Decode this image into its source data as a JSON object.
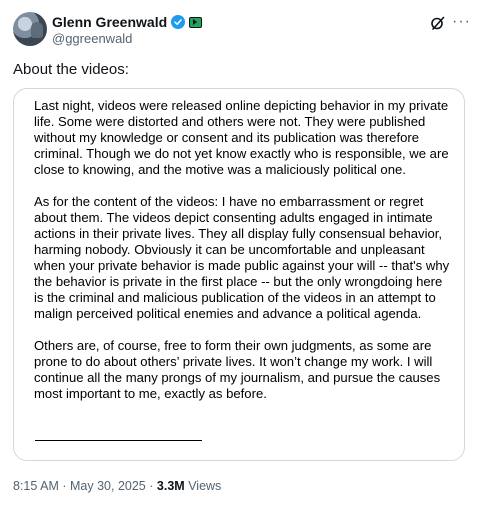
{
  "author": {
    "name": "Glenn Greenwald",
    "handle": "@ggreenwald"
  },
  "tweet": {
    "intro_text": "About the videos:",
    "paragraphs": [
      "Last night, videos were released online depicting behavior in my private life. Some were distorted and others were not. They were published without my knowledge or consent and its publication was therefore criminal. Though we do not yet know exactly who is responsible, we are close to knowing, and the motive was a maliciously political one.",
      "As for the content of the videos: I have no embarrassment or regret about them. The videos depict consenting adults engaged in intimate actions in their private lives. They all display fully consensual behavior, harming nobody. Obviously it can be uncomfortable and unpleasant when your private behavior is made public against your will -- that's why the behavior is private in the first place -- but the only wrongdoing here is the criminal and malicious publication of the videos in an attempt to malign perceived political enemies and advance a political agenda.",
      "Others are, of course, free to form their own judgments, as some are prone to do about others’ private lives. It won’t change my work. I will continue all the many prongs of my journalism, and pursue the causes most important to me, exactly as before."
    ]
  },
  "meta": {
    "time": "8:15 AM",
    "separator": "·",
    "date": "May 30, 2025",
    "views_count": "3.3M",
    "views_label": "Views"
  },
  "icons": {
    "verified": "verified-badge-icon",
    "affiliate": "affiliate-badge-icon",
    "grok": "grok-icon",
    "more": "more-options-icon"
  },
  "colors": {
    "accent": "#1d9bf0",
    "secondary_text": "#536471",
    "border": "#cfd9de"
  }
}
